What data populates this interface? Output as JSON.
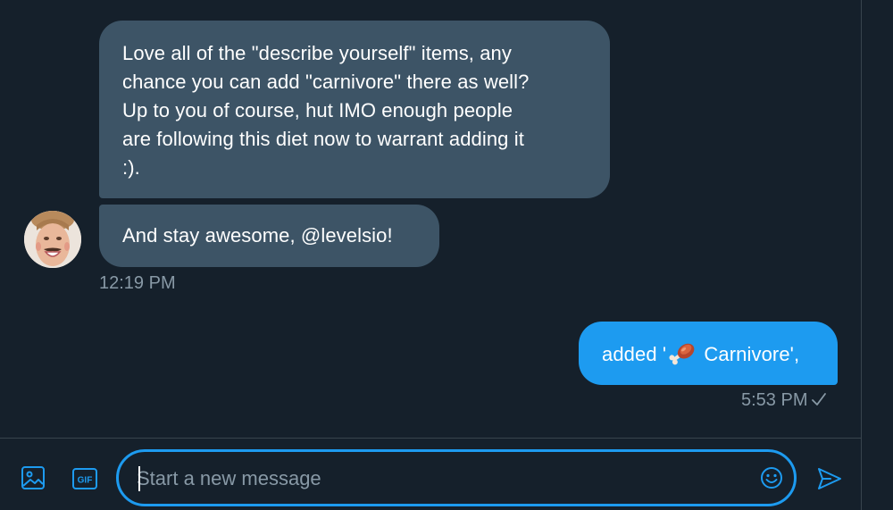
{
  "messages": [
    {
      "direction": "incoming",
      "lines": [
        "Love all of the \"describe yourself\" items, any",
        "chance you can add \"carnivore\" there as well?",
        "Up to you of course, hut IMO enough people",
        "are following this diet now to warrant adding it",
        ":)."
      ]
    },
    {
      "direction": "incoming",
      "text": "And stay awesome, @levelsio!",
      "time": "12:19 PM"
    },
    {
      "direction": "outgoing",
      "text_before": "added '",
      "emoji": "meat-on-bone-icon",
      "text_after": " Carnivore',",
      "time": "5:53 PM",
      "status_icon": "checkmark-icon"
    }
  ],
  "composer": {
    "placeholder": "Start a new message",
    "value": "",
    "icons": [
      "image-icon",
      "gif-icon",
      "emoji-icon",
      "send-icon"
    ]
  },
  "colors": {
    "background": "#15202b",
    "incoming_bubble": "#3d5466",
    "outgoing_bubble": "#1d9bf0",
    "accent": "#1d9bf0",
    "muted_text": "#8899a6"
  }
}
